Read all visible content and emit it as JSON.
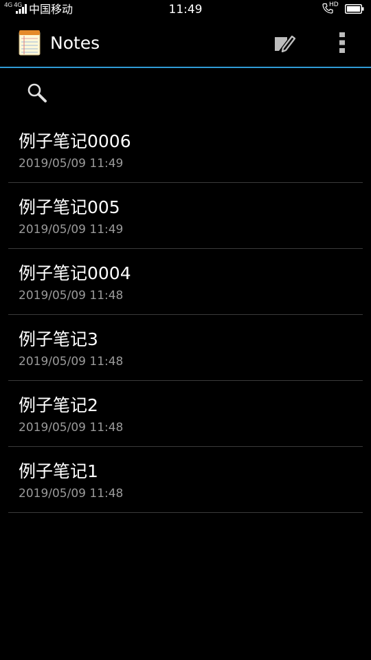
{
  "status_bar": {
    "network": "4G 4G",
    "carrier": "中国移动",
    "time": "11:49",
    "hd_label": "HD"
  },
  "action_bar": {
    "title": "Notes",
    "accent_color": "#2f9bd6"
  },
  "notes": [
    {
      "title": "例子笔记0006",
      "date": "2019/05/09 11:49"
    },
    {
      "title": "例子笔记005",
      "date": "2019/05/09 11:49"
    },
    {
      "title": "例子笔记0004",
      "date": "2019/05/09 11:48"
    },
    {
      "title": "例子笔记3",
      "date": "2019/05/09 11:48"
    },
    {
      "title": "例子笔记2",
      "date": "2019/05/09 11:48"
    },
    {
      "title": "例子笔记1",
      "date": "2019/05/09 11:48"
    }
  ],
  "icons": {
    "app": "notepad-icon",
    "new_note": "compose-icon",
    "overflow": "more-vertical-icon",
    "search": "search-icon"
  }
}
